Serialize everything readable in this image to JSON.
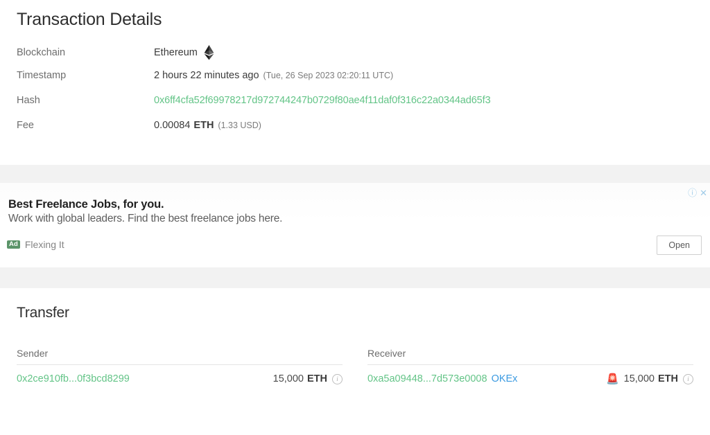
{
  "transaction_details": {
    "title": "Transaction Details",
    "rows": [
      {
        "label": "Blockchain",
        "value": "Ethereum",
        "icon": "ethereum-logo-icon"
      },
      {
        "label": "Timestamp",
        "value": "2 hours 22 minutes ago",
        "sub": "(Tue, 26 Sep 2023 02:20:11 UTC)"
      },
      {
        "label": "Hash",
        "value": "0x6ff4cfa52f69978217d972744247b0729f80ae4f11daf0f316c22a0344ad65f3"
      },
      {
        "label": "Fee",
        "value": "0.00084",
        "unit": "ETH",
        "sub": "(1.33 USD)"
      }
    ]
  },
  "ad": {
    "headline": "Best Freelance Jobs, for you.",
    "description": "Work with global leaders. Find the best freelance jobs here.",
    "badge": "Ad",
    "advertiser": "Flexing It",
    "open_label": "Open",
    "info_icon": "ⓘ",
    "close_icon": "✕"
  },
  "transfer": {
    "title": "Transfer",
    "columns": [
      {
        "header": "Sender",
        "address": "0x2ce910fb...0f3bcd8299",
        "entity": "",
        "flag": "",
        "amount": "15,000",
        "unit": "ETH",
        "info_icon": "i"
      },
      {
        "header": "Receiver",
        "address": "0xa5a09448...7d573e0008",
        "entity": "OKEx",
        "flag": "🚨",
        "amount": "15,000",
        "unit": "ETH",
        "info_icon": "i"
      }
    ]
  },
  "colors": {
    "link_green": "#63c487",
    "link_blue": "#3b9ae1",
    "ad_badge_green": "#5b9469",
    "page_background": "#f2f2f2",
    "card_background": "#ffffff"
  }
}
